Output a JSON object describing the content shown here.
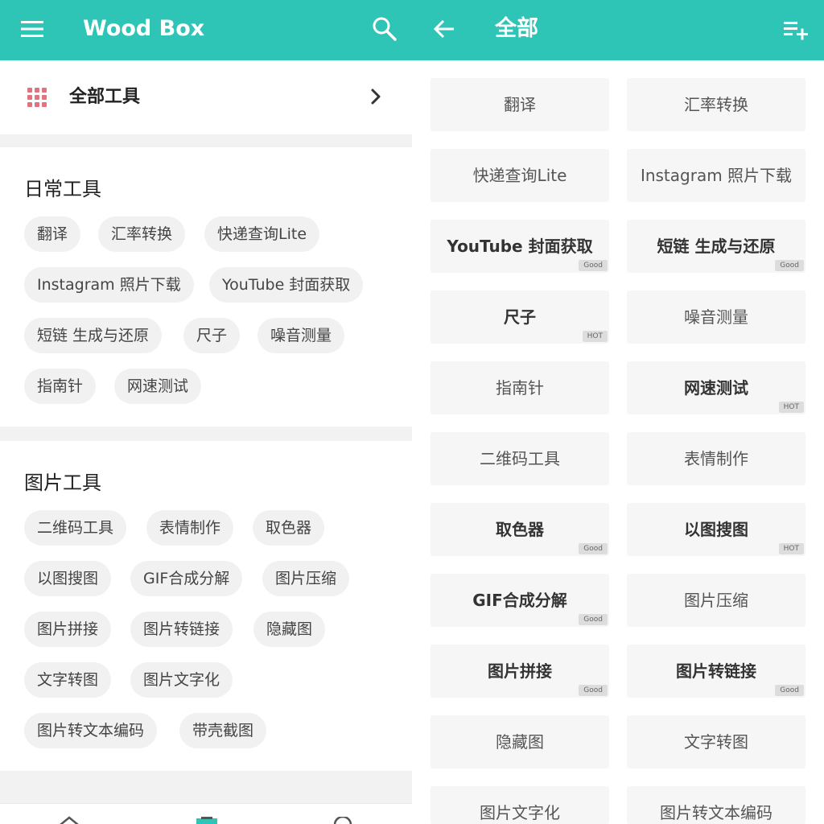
{
  "left": {
    "header": {
      "title": "Wood Box"
    },
    "all_tools": {
      "label": "全部工具"
    },
    "sections": [
      {
        "title": "日常工具",
        "chips": [
          "翻译",
          "汇率转换",
          "快递查询Lite",
          "Instagram 照片下载",
          "YouTube 封面获取",
          "短链 生成与还原",
          "尺子",
          "噪音测量",
          "指南针",
          "网速测试"
        ]
      },
      {
        "title": "图片工具",
        "chips": [
          "二维码工具",
          "表情制作",
          "取色器",
          "以图搜图",
          "GIF合成分解",
          "图片压缩",
          "图片拼接",
          "图片转链接",
          "隐藏图",
          "文字转图",
          "图片文字化",
          "图片转文本编码",
          "带壳截图"
        ]
      }
    ]
  },
  "right": {
    "header": {
      "title": "全部"
    },
    "cards": [
      {
        "label": "翻译",
        "badge": ""
      },
      {
        "label": "汇率转换",
        "badge": ""
      },
      {
        "label": "快递查询Lite",
        "badge": ""
      },
      {
        "label": "Instagram 照片下载",
        "badge": ""
      },
      {
        "label": "YouTube 封面获取",
        "badge": "Good"
      },
      {
        "label": "短链 生成与还原",
        "badge": "Good"
      },
      {
        "label": "尺子",
        "badge": "HOT"
      },
      {
        "label": "噪音测量",
        "badge": ""
      },
      {
        "label": "指南针",
        "badge": ""
      },
      {
        "label": "网速测试",
        "badge": "HOT"
      },
      {
        "label": "二维码工具",
        "badge": ""
      },
      {
        "label": "表情制作",
        "badge": ""
      },
      {
        "label": "取色器",
        "badge": "Good"
      },
      {
        "label": "以图搜图",
        "badge": "HOT"
      },
      {
        "label": "GIF合成分解",
        "badge": "Good"
      },
      {
        "label": "图片压缩",
        "badge": ""
      },
      {
        "label": "图片拼接",
        "badge": "Good"
      },
      {
        "label": "图片转链接",
        "badge": "Good"
      },
      {
        "label": "隐藏图",
        "badge": ""
      },
      {
        "label": "文字转图",
        "badge": ""
      },
      {
        "label": "图片文字化",
        "badge": ""
      },
      {
        "label": "图片转文本编码",
        "badge": ""
      }
    ]
  },
  "colors": {
    "accent": "#2ec4b6",
    "grid_icon": "#e0737d",
    "chip_bg": "#f1f1f1",
    "card_bg": "#f6f6f6",
    "badge_bg": "#dddddd"
  },
  "icons": {
    "menu": "menu-icon",
    "search": "search-icon",
    "back": "arrow-left-icon",
    "playlist_add": "playlist-add-icon",
    "grid": "grid-icon",
    "chevron": "chevron-right-icon"
  }
}
